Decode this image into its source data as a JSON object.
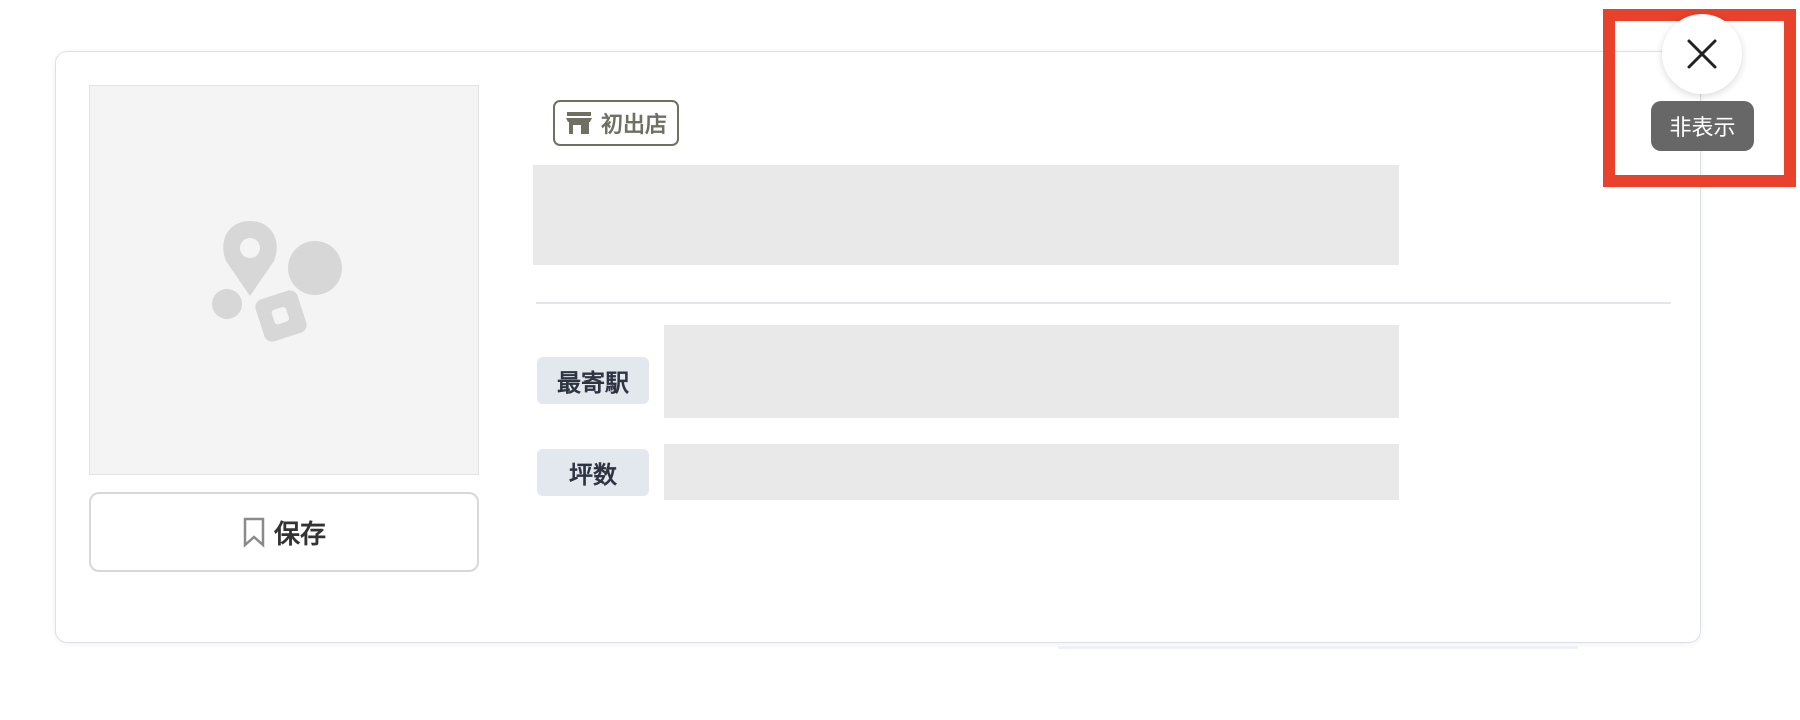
{
  "card": {
    "tag_label": "初出店",
    "save_label": "保存",
    "station_label": "最寄駅",
    "area_label": "坪数"
  },
  "overlay": {
    "hide_label": "非表示"
  },
  "icons": {
    "close": "close-icon",
    "store": "store-icon",
    "bookmark": "bookmark-icon",
    "placeholder": "placeholder-image-icon"
  },
  "colors": {
    "highlight": "#e8412c",
    "tag_border": "#6f6f62",
    "label_chip_bg": "#e3e7ee",
    "skeleton": "#e9e9e9",
    "tooltip_bg": "#676767"
  }
}
